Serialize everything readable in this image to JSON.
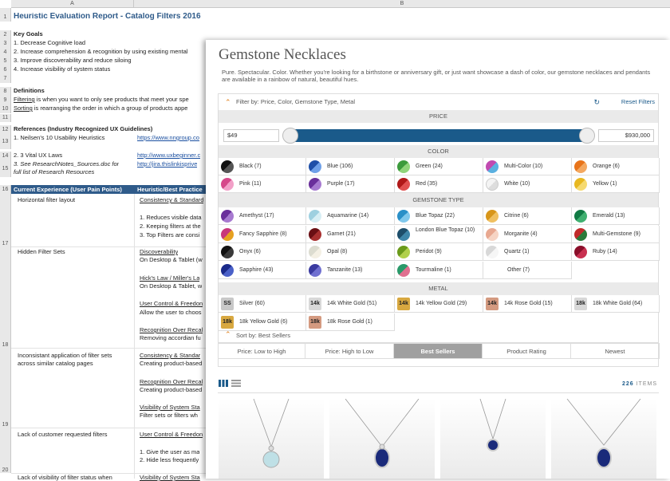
{
  "sheet": {
    "col_a": "A",
    "col_b": "B",
    "title": "Heuristic Evaluation Report - Catalog Filters 2016",
    "rows_nums": [
      "1",
      "2",
      "3",
      "4",
      "5",
      "6",
      "7",
      "8",
      "9",
      "10",
      "11",
      "12",
      "13",
      "14",
      "15",
      "16",
      "17",
      "18",
      "19",
      "20"
    ],
    "key_goals": "Key Goals",
    "goals": [
      "1. Decrease Cognitive load",
      "2. Increase comprehension & recognition by using existing mental",
      "3. Improve discoverability and reduce siloing",
      "4. Increase visibility of system status"
    ],
    "definitions": "Definitions",
    "def_filtering_term": "Filtering",
    "def_filtering": " is when you want to only see products that meet your spe",
    "def_sorting_term": "Sorting",
    "def_sorting": " is rearranging the order in which a group of products appe",
    "references": "References (Industry Recognized UX Guidelines)",
    "ref1": "1. Neilsen's 10 Usability Heuristics",
    "ref1_link": "https://www.nngroup.co",
    "ref2": "2. 3 Vital UX Laws",
    "ref2_link": "http://www.uxbeginner.c",
    "ref3a": "3. See ",
    "ref3b": "ResearchNotes_Sources.doc",
    "ref3c": " for",
    "ref3d": "full list of Research Resources",
    "ref3_link": "http://jira.thislinkisprive",
    "hdr_a": "Current Experience (User Pain Points)",
    "hdr_b": "Heuristic/Best Practice",
    "r17_a": "Horizontal filter layout",
    "r17_b": [
      "Consistency & Standard",
      "1. Reduces visible data",
      "2. Keeping filters at the",
      "3. Top Filters are consi"
    ],
    "r18_a": "Hidden Filter Sets",
    "r18_b": [
      "Discoverability",
      "On Desktop & Tablet (w",
      "Hick's Law / Miller's La",
      "On Desktop & Tablet, w",
      "User Control & Freedon",
      "Allow the user to choos",
      "Recognition Over Recal",
      "Removing accordian fu"
    ],
    "r19_a": [
      "Inconsistant application of filter sets",
      "across similar catalog pages"
    ],
    "r19_b": [
      "Consistency & Standar",
      "Creating product-based",
      "Recognition Over Recal",
      "Creating product-based",
      "Visibility of System Sta",
      "Filter sets or filters wh"
    ],
    "r20_a": "Lack of customer requested filters",
    "r20_b": [
      "User Control & Freedon",
      "1. Give the user as ma",
      "2. Hide less frequently"
    ],
    "r21_a": "Lack of visibility of filter status when",
    "r21_b": "Visibility of System Sta"
  },
  "panel": {
    "title": "Gemstone Necklaces",
    "description": "Pure. Spectacular. Color. Whether you're looking for a birthstone or anniversary gift, or just want showcase a dash of color, our gemstone necklaces and pendants are available in a rainbow of natural, beautiful hues.",
    "filter_by": "Filter by: Price, Color, Gemstone Type, Metal",
    "reset": "Reset Filters",
    "price_head": "PRICE",
    "price_min": "$49",
    "price_max": "$930,000",
    "color_head": "COLOR",
    "colors": [
      {
        "label": "Black (7)",
        "c1": "#111",
        "c2": "#555"
      },
      {
        "label": "Blue (106)",
        "c1": "#1f4fa8",
        "c2": "#6fa0e8"
      },
      {
        "label": "Green (24)",
        "c1": "#3c9b3c",
        "c2": "#8fd47a"
      },
      {
        "label": "Multi-Color (10)",
        "c1": "#c04ab0",
        "c2": "#5ab0e0"
      },
      {
        "label": "Orange (6)",
        "c1": "#e8741a",
        "c2": "#f4a860"
      },
      {
        "label": "Pink (11)",
        "c1": "#d6488a",
        "c2": "#f2a0c8"
      },
      {
        "label": "Purple (17)",
        "c1": "#6a2f9b",
        "c2": "#a77ad0"
      },
      {
        "label": "Red (35)",
        "c1": "#b01818",
        "c2": "#e05050"
      },
      {
        "label": "White (10)",
        "c1": "#f4f4f4",
        "c2": "#ddd"
      },
      {
        "label": "Yellow (1)",
        "c1": "#e8b820",
        "c2": "#f6da70"
      }
    ],
    "gem_head": "GEMSTONE TYPE",
    "gems": [
      {
        "label": "Amethyst (17)",
        "c1": "#6a2f9b",
        "c2": "#a77ad0"
      },
      {
        "label": "Aquamarine (14)",
        "c1": "#9ed0e0",
        "c2": "#d6eef4"
      },
      {
        "label": "Blue Topaz (22)",
        "c1": "#2a90c8",
        "c2": "#80c8ec"
      },
      {
        "label": "Citrine (6)",
        "c1": "#d8961a",
        "c2": "#f0c060"
      },
      {
        "label": "Emerald (13)",
        "c1": "#117a44",
        "c2": "#3fb070"
      },
      {
        "label": "Fancy Sapphire (8)",
        "c1": "#c8367a",
        "c2": "#e6a020"
      },
      {
        "label": "Garnet (21)",
        "c1": "#6a0f14",
        "c2": "#a83030"
      },
      {
        "label": "London Blue Topaz (10)",
        "c1": "#1d4e6a",
        "c2": "#3e86a8"
      },
      {
        "label": "Morganite (4)",
        "c1": "#e8a890",
        "c2": "#f6d4c4"
      },
      {
        "label": "Multi-Gemstone (9)",
        "c1": "#c02a2a",
        "c2": "#2a7a3a"
      },
      {
        "label": "Onyx (6)",
        "c1": "#111",
        "c2": "#3a3a3a"
      },
      {
        "label": "Opal (8)",
        "c1": "#dcdcd0",
        "c2": "#f4f0e4"
      },
      {
        "label": "Peridot (9)",
        "c1": "#6a9a1a",
        "c2": "#b0d04a"
      },
      {
        "label": "Quartz (1)",
        "c1": "#d8d8d8",
        "c2": "#f6f6f6"
      },
      {
        "label": "Ruby (14)",
        "c1": "#8a0f2a",
        "c2": "#c83050"
      },
      {
        "label": "Sapphire (43)",
        "c1": "#1a2a8a",
        "c2": "#4a60c8"
      },
      {
        "label": "Tanzanite (13)",
        "c1": "#3a3aa0",
        "c2": "#7070d0"
      },
      {
        "label": "Tourmaline (1)",
        "c1": "#2a9a6a",
        "c2": "#e07090"
      },
      {
        "label": "Other (7)",
        "c1": "",
        "c2": ""
      }
    ],
    "metal_head": "METAL",
    "metals": [
      {
        "badge": "SS",
        "label": "Silver (60)",
        "bg": "#c8c8c8",
        "fg": "#222"
      },
      {
        "badge": "14k",
        "label": "14k White Gold (51)",
        "bg": "#d8d8d8",
        "fg": "#222"
      },
      {
        "badge": "14k",
        "label": "14k Yellow Gold (29)",
        "bg": "#d8a840",
        "fg": "#222"
      },
      {
        "badge": "14k",
        "label": "14k Rose Gold (15)",
        "bg": "#d49a80",
        "fg": "#222"
      },
      {
        "badge": "18k",
        "label": "18k White Gold (64)",
        "bg": "#d8d8d8",
        "fg": "#222"
      },
      {
        "badge": "18k",
        "label": "18k Yellow Gold (6)",
        "bg": "#d8a840",
        "fg": "#222"
      },
      {
        "badge": "18k",
        "label": "18k Rose Gold (1)",
        "bg": "#d49a80",
        "fg": "#222"
      }
    ],
    "sort_by": "Sort by: Best Sellers",
    "sort_options": [
      "Price: Low to High",
      "Price: High to Low",
      "Best Sellers",
      "Product Rating",
      "Newest"
    ],
    "items_count": "226",
    "items_label": "ITEMS",
    "accent": "#1a5a8a",
    "active_sort": "#a0a0a0"
  }
}
